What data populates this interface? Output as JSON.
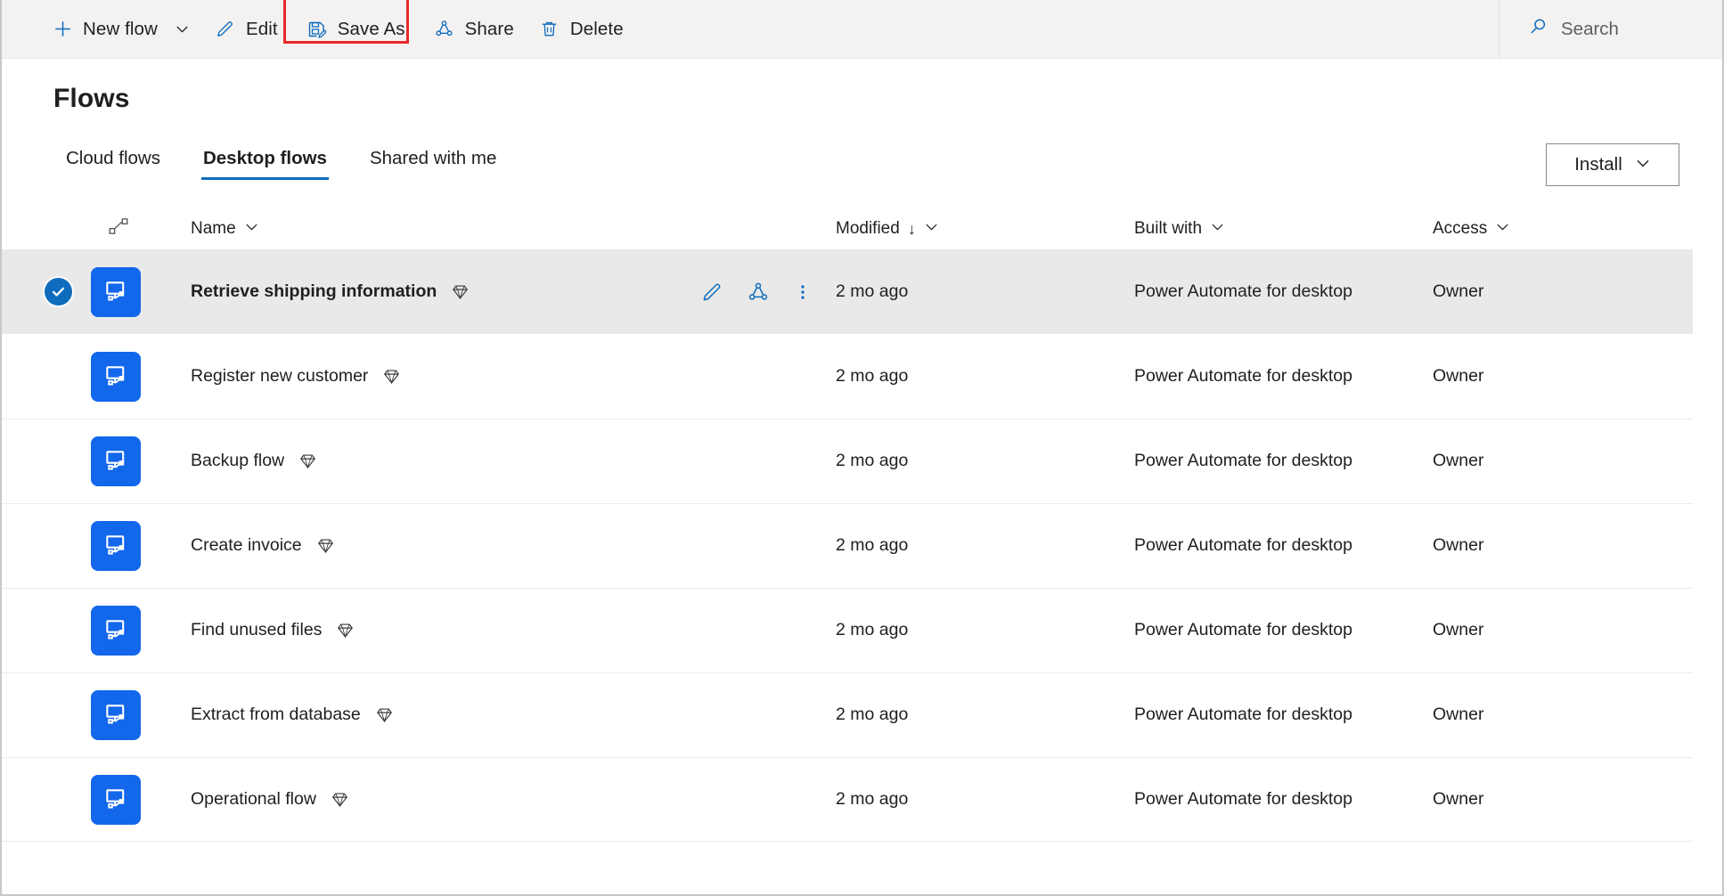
{
  "toolbar": {
    "new_flow": "New flow",
    "edit": "Edit",
    "save_as": "Save As",
    "share": "Share",
    "delete": "Delete",
    "highlight_color": "#e8282a",
    "accent_color": "#0f6cbd"
  },
  "search": {
    "placeholder": "Search",
    "icon": "search-icon"
  },
  "header": {
    "title": "Flows",
    "install_label": "Install"
  },
  "tabs": [
    {
      "label": "Cloud flows",
      "active": false
    },
    {
      "label": "Desktop flows",
      "active": true
    },
    {
      "label": "Shared with me",
      "active": false
    }
  ],
  "table": {
    "columns": {
      "type_icon": "flow-type-icon",
      "name": "Name",
      "modified": "Modified",
      "modified_sort": "↓",
      "built_with": "Built with",
      "access": "Access"
    },
    "row_actions": {
      "edit": "edit-icon",
      "share": "share-icon",
      "more": "more-options-icon"
    },
    "rows": [
      {
        "name": "Retrieve shipping information",
        "premium": true,
        "modified": "2 mo ago",
        "built_with": "Power Automate for desktop",
        "access": "Owner",
        "selected": true
      },
      {
        "name": "Register new customer",
        "premium": true,
        "modified": "2 mo ago",
        "built_with": "Power Automate for desktop",
        "access": "Owner",
        "selected": false
      },
      {
        "name": "Backup flow",
        "premium": true,
        "modified": "2 mo ago",
        "built_with": "Power Automate for desktop",
        "access": "Owner",
        "selected": false
      },
      {
        "name": "Create invoice",
        "premium": true,
        "modified": "2 mo ago",
        "built_with": "Power Automate for desktop",
        "access": "Owner",
        "selected": false
      },
      {
        "name": "Find unused files",
        "premium": true,
        "modified": "2 mo ago",
        "built_with": "Power Automate for desktop",
        "access": "Owner",
        "selected": false
      },
      {
        "name": "Extract from database",
        "premium": true,
        "modified": "2 mo ago",
        "built_with": "Power Automate for desktop",
        "access": "Owner",
        "selected": false
      },
      {
        "name": "Operational flow",
        "premium": true,
        "modified": "2 mo ago",
        "built_with": "Power Automate for desktop",
        "access": "Owner",
        "selected": false
      }
    ]
  }
}
